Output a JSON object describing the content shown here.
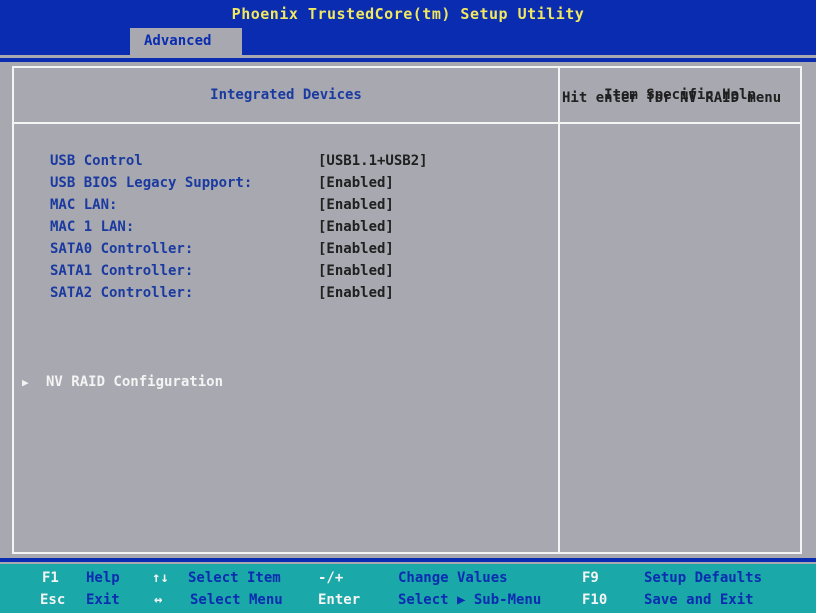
{
  "title": "Phoenix TrustedCore(tm) Setup Utility",
  "menu": {
    "active_tab": "Advanced"
  },
  "panel": {
    "title": "Integrated Devices",
    "help_title": "Item Specific Help",
    "help_text": "Hit enter for NV RAID menu"
  },
  "settings": [
    {
      "label": "USB Control",
      "value": "[USB1.1+USB2]"
    },
    {
      "label": "USB BIOS Legacy Support:",
      "value": "[Enabled]"
    },
    {
      "label": "MAC LAN:",
      "value": "[Enabled]"
    },
    {
      "label": "MAC 1 LAN:",
      "value": "[Enabled]"
    },
    {
      "label": "SATA0 Controller:",
      "value": "[Enabled]"
    },
    {
      "label": "SATA1 Controller:",
      "value": "[Enabled]"
    },
    {
      "label": "SATA2 Controller:",
      "value": "[Enabled]"
    }
  ],
  "submenu": {
    "arrow": "▶",
    "label": "NV RAID Configuration"
  },
  "footer": {
    "row1": [
      {
        "key": "F1",
        "desc": "Help"
      },
      {
        "key": "↑↓",
        "desc": "Select Item"
      },
      {
        "key": "-/+",
        "desc": "Change Values"
      },
      {
        "key": "F9",
        "desc": "Setup Defaults"
      }
    ],
    "row2": [
      {
        "key": "Esc",
        "desc": "Exit"
      },
      {
        "key": "↔",
        "desc": "Select Menu"
      },
      {
        "key": "Enter",
        "desc": "Select ▶ Sub-Menu"
      },
      {
        "key": "F10",
        "desc": "Save and Exit"
      }
    ]
  }
}
